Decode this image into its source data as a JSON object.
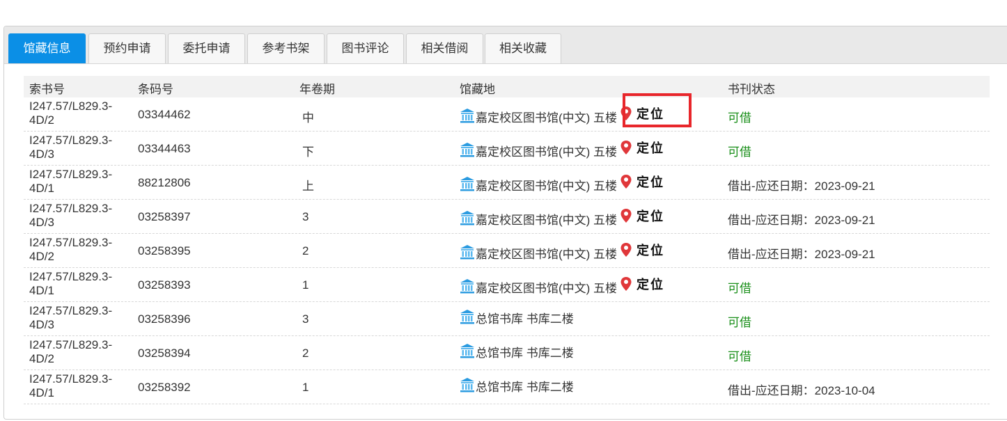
{
  "tabs": [
    {
      "label": "馆藏信息",
      "active": true
    },
    {
      "label": "预约申请"
    },
    {
      "label": "委托申请"
    },
    {
      "label": "参考书架"
    },
    {
      "label": "图书评论"
    },
    {
      "label": "相关借阅"
    },
    {
      "label": "相关收藏"
    }
  ],
  "table": {
    "headers": {
      "callno": "索书号",
      "barcode": "条码号",
      "volume": "年卷期",
      "location": "馆藏地",
      "status": "书刊状态"
    },
    "rows": [
      {
        "callno": "I247.57/L829.3-4D/2",
        "barcode": "03344462",
        "volume": "中",
        "location": "嘉定校区图书馆(中文) 五楼",
        "locate": "定位",
        "status": "可借",
        "available": true
      },
      {
        "callno": "I247.57/L829.3-4D/3",
        "barcode": "03344463",
        "volume": "下",
        "location": "嘉定校区图书馆(中文) 五楼",
        "locate": "定位",
        "status": "可借",
        "available": true
      },
      {
        "callno": "I247.57/L829.3-4D/1",
        "barcode": "88212806",
        "volume": "上",
        "location": "嘉定校区图书馆(中文) 五楼",
        "locate": "定位",
        "status": "借出-应还日期：2023-09-21",
        "available": false
      },
      {
        "callno": "I247.57/L829.3-4D/3",
        "barcode": "03258397",
        "volume": "3",
        "location": "嘉定校区图书馆(中文) 五楼",
        "locate": "定位",
        "status": "借出-应还日期：2023-09-21",
        "available": false
      },
      {
        "callno": "I247.57/L829.3-4D/2",
        "barcode": "03258395",
        "volume": "2",
        "location": "嘉定校区图书馆(中文) 五楼",
        "locate": "定位",
        "status": "借出-应还日期：2023-09-21",
        "available": false
      },
      {
        "callno": "I247.57/L829.3-4D/1",
        "barcode": "03258393",
        "volume": "1",
        "location": "嘉定校区图书馆(中文) 五楼",
        "locate": "定位",
        "status": "可借",
        "available": true
      },
      {
        "callno": "I247.57/L829.3-4D/3",
        "barcode": "03258396",
        "volume": "3",
        "location": "总馆书库 书库二楼",
        "locate": "",
        "status": "可借",
        "available": true
      },
      {
        "callno": "I247.57/L829.3-4D/2",
        "barcode": "03258394",
        "volume": "2",
        "location": "总馆书库 书库二楼",
        "locate": "",
        "status": "可借",
        "available": true
      },
      {
        "callno": "I247.57/L829.3-4D/1",
        "barcode": "03258392",
        "volume": "1",
        "location": "总馆书库 书库二楼",
        "locate": "",
        "status": "借出-应还日期：2023-10-04",
        "available": false
      }
    ]
  },
  "colors": {
    "active_tab": "#0b8fe6",
    "available": "#1a8f1a",
    "highlight": "#e8262b",
    "pin": "#e0373a"
  },
  "icons": {
    "library": "library-building-icon",
    "pin": "map-pin-icon"
  }
}
